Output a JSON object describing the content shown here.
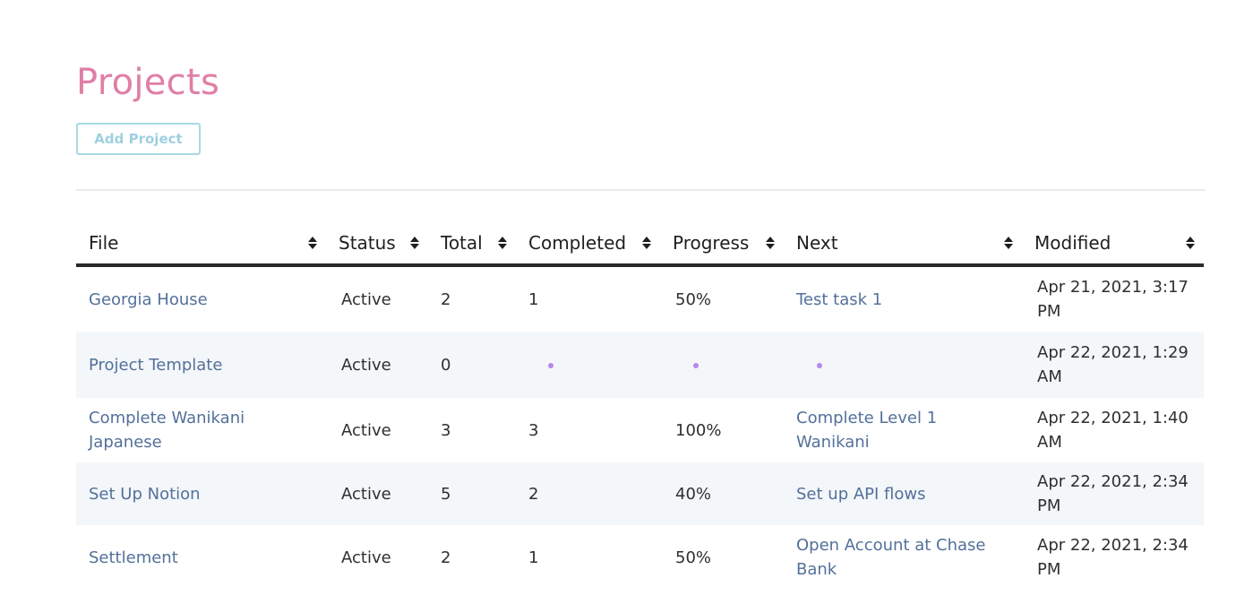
{
  "page": {
    "title": "Projects",
    "add_button_label": "Add Project"
  },
  "table": {
    "columns": [
      {
        "key": "file",
        "label": "File"
      },
      {
        "key": "status",
        "label": "Status"
      },
      {
        "key": "total",
        "label": "Total"
      },
      {
        "key": "completed",
        "label": "Completed"
      },
      {
        "key": "progress",
        "label": "Progress"
      },
      {
        "key": "next",
        "label": "Next"
      },
      {
        "key": "modified",
        "label": "Modified"
      }
    ],
    "rows": [
      {
        "file": "Georgia House",
        "status": "Active",
        "total": "2",
        "completed": "1",
        "progress": "50%",
        "next": "Test task 1",
        "modified": "Apr 21, 2021, 3:17 PM"
      },
      {
        "file": "Project Template",
        "status": "Active",
        "total": "0",
        "completed": "",
        "progress": "",
        "next": "",
        "modified": "Apr 22, 2021, 1:29 AM"
      },
      {
        "file": "Complete Wanikani Japanese",
        "status": "Active",
        "total": "3",
        "completed": "3",
        "progress": "100%",
        "next": "Complete Level 1 Wanikani",
        "modified": "Apr 22, 2021, 1:40 AM"
      },
      {
        "file": "Set Up Notion",
        "status": "Active",
        "total": "5",
        "completed": "2",
        "progress": "40%",
        "next": "Set up API flows",
        "modified": "Apr 22, 2021, 2:34 PM"
      },
      {
        "file": "Settlement",
        "status": "Active",
        "total": "2",
        "completed": "1",
        "progress": "50%",
        "next": "Open Account at Chase Bank",
        "modified": "Apr 22, 2021, 2:34 PM"
      }
    ]
  },
  "icons": {
    "sort": "sort-icon",
    "empty_value": "dot-icon"
  },
  "colors": {
    "title": "#e07fa6",
    "link": "#53709a",
    "button_border": "#a9d8e6",
    "button_text": "#9fd0e0",
    "stripe": "#f4f7fa",
    "empty_dot": "#b886f0"
  }
}
